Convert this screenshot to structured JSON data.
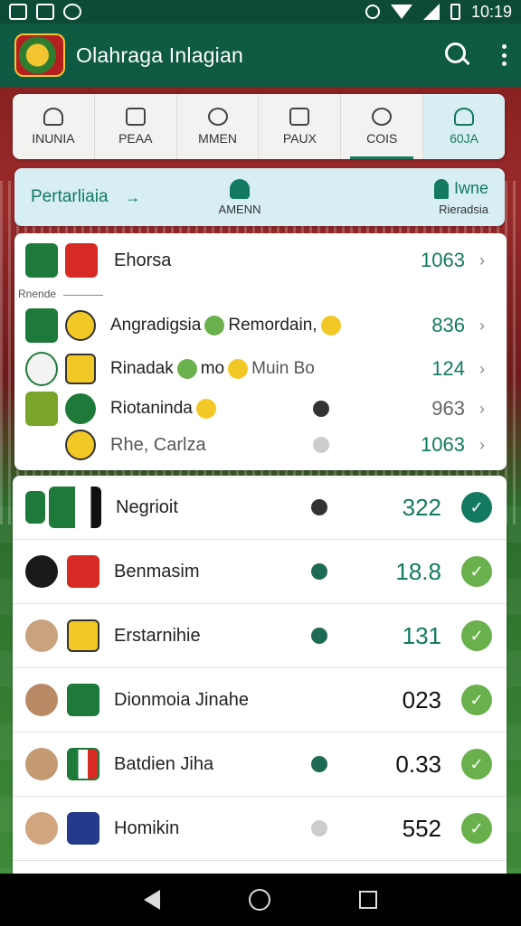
{
  "status_bar": {
    "time": "10:19"
  },
  "app": {
    "title": "Olahraga Inlagian"
  },
  "tabs": [
    {
      "label": "INUNIA",
      "icon": "person-icon"
    },
    {
      "label": "PEAA",
      "icon": "tv-icon"
    },
    {
      "label": "MMEN",
      "icon": "search-icon"
    },
    {
      "label": "PAUX",
      "icon": "book-icon"
    },
    {
      "label": "COIS",
      "icon": "team-icon"
    },
    {
      "label": "60JA",
      "icon": "user-icon"
    }
  ],
  "banner": {
    "title": "Pertarliaia",
    "arrow": "→",
    "mid_label": "AMENN",
    "right_title": "Iwne",
    "right_sub": "Rieradsia"
  },
  "card1": {
    "divider_label": "Rnende",
    "rows": [
      {
        "name": "Ehorsa",
        "value": "1063"
      },
      {
        "name": "Angradigsia",
        "mid1": "Remordain,",
        "value": "836"
      },
      {
        "name": "Rinadak",
        "mid1": "mo",
        "mid2": "Muin Bo",
        "value": "124"
      },
      {
        "name": "Riotaninda",
        "value": "963"
      },
      {
        "name": "Rhe, Carlza",
        "value": "1063"
      }
    ]
  },
  "list": [
    {
      "name": "Negrioit",
      "value": "322"
    },
    {
      "name": "Benmasim",
      "value": "18.8"
    },
    {
      "name": "Erstarnihie",
      "value": "131"
    },
    {
      "name": "Dionmoia Jinahe",
      "value": "023"
    },
    {
      "name": "Batdien Jiha",
      "value": "0.33"
    },
    {
      "name": "Homikin",
      "value": "552"
    }
  ],
  "colors": {
    "primary": "#0e5a43",
    "accent": "#137a5f",
    "check": "#6ab04c"
  }
}
